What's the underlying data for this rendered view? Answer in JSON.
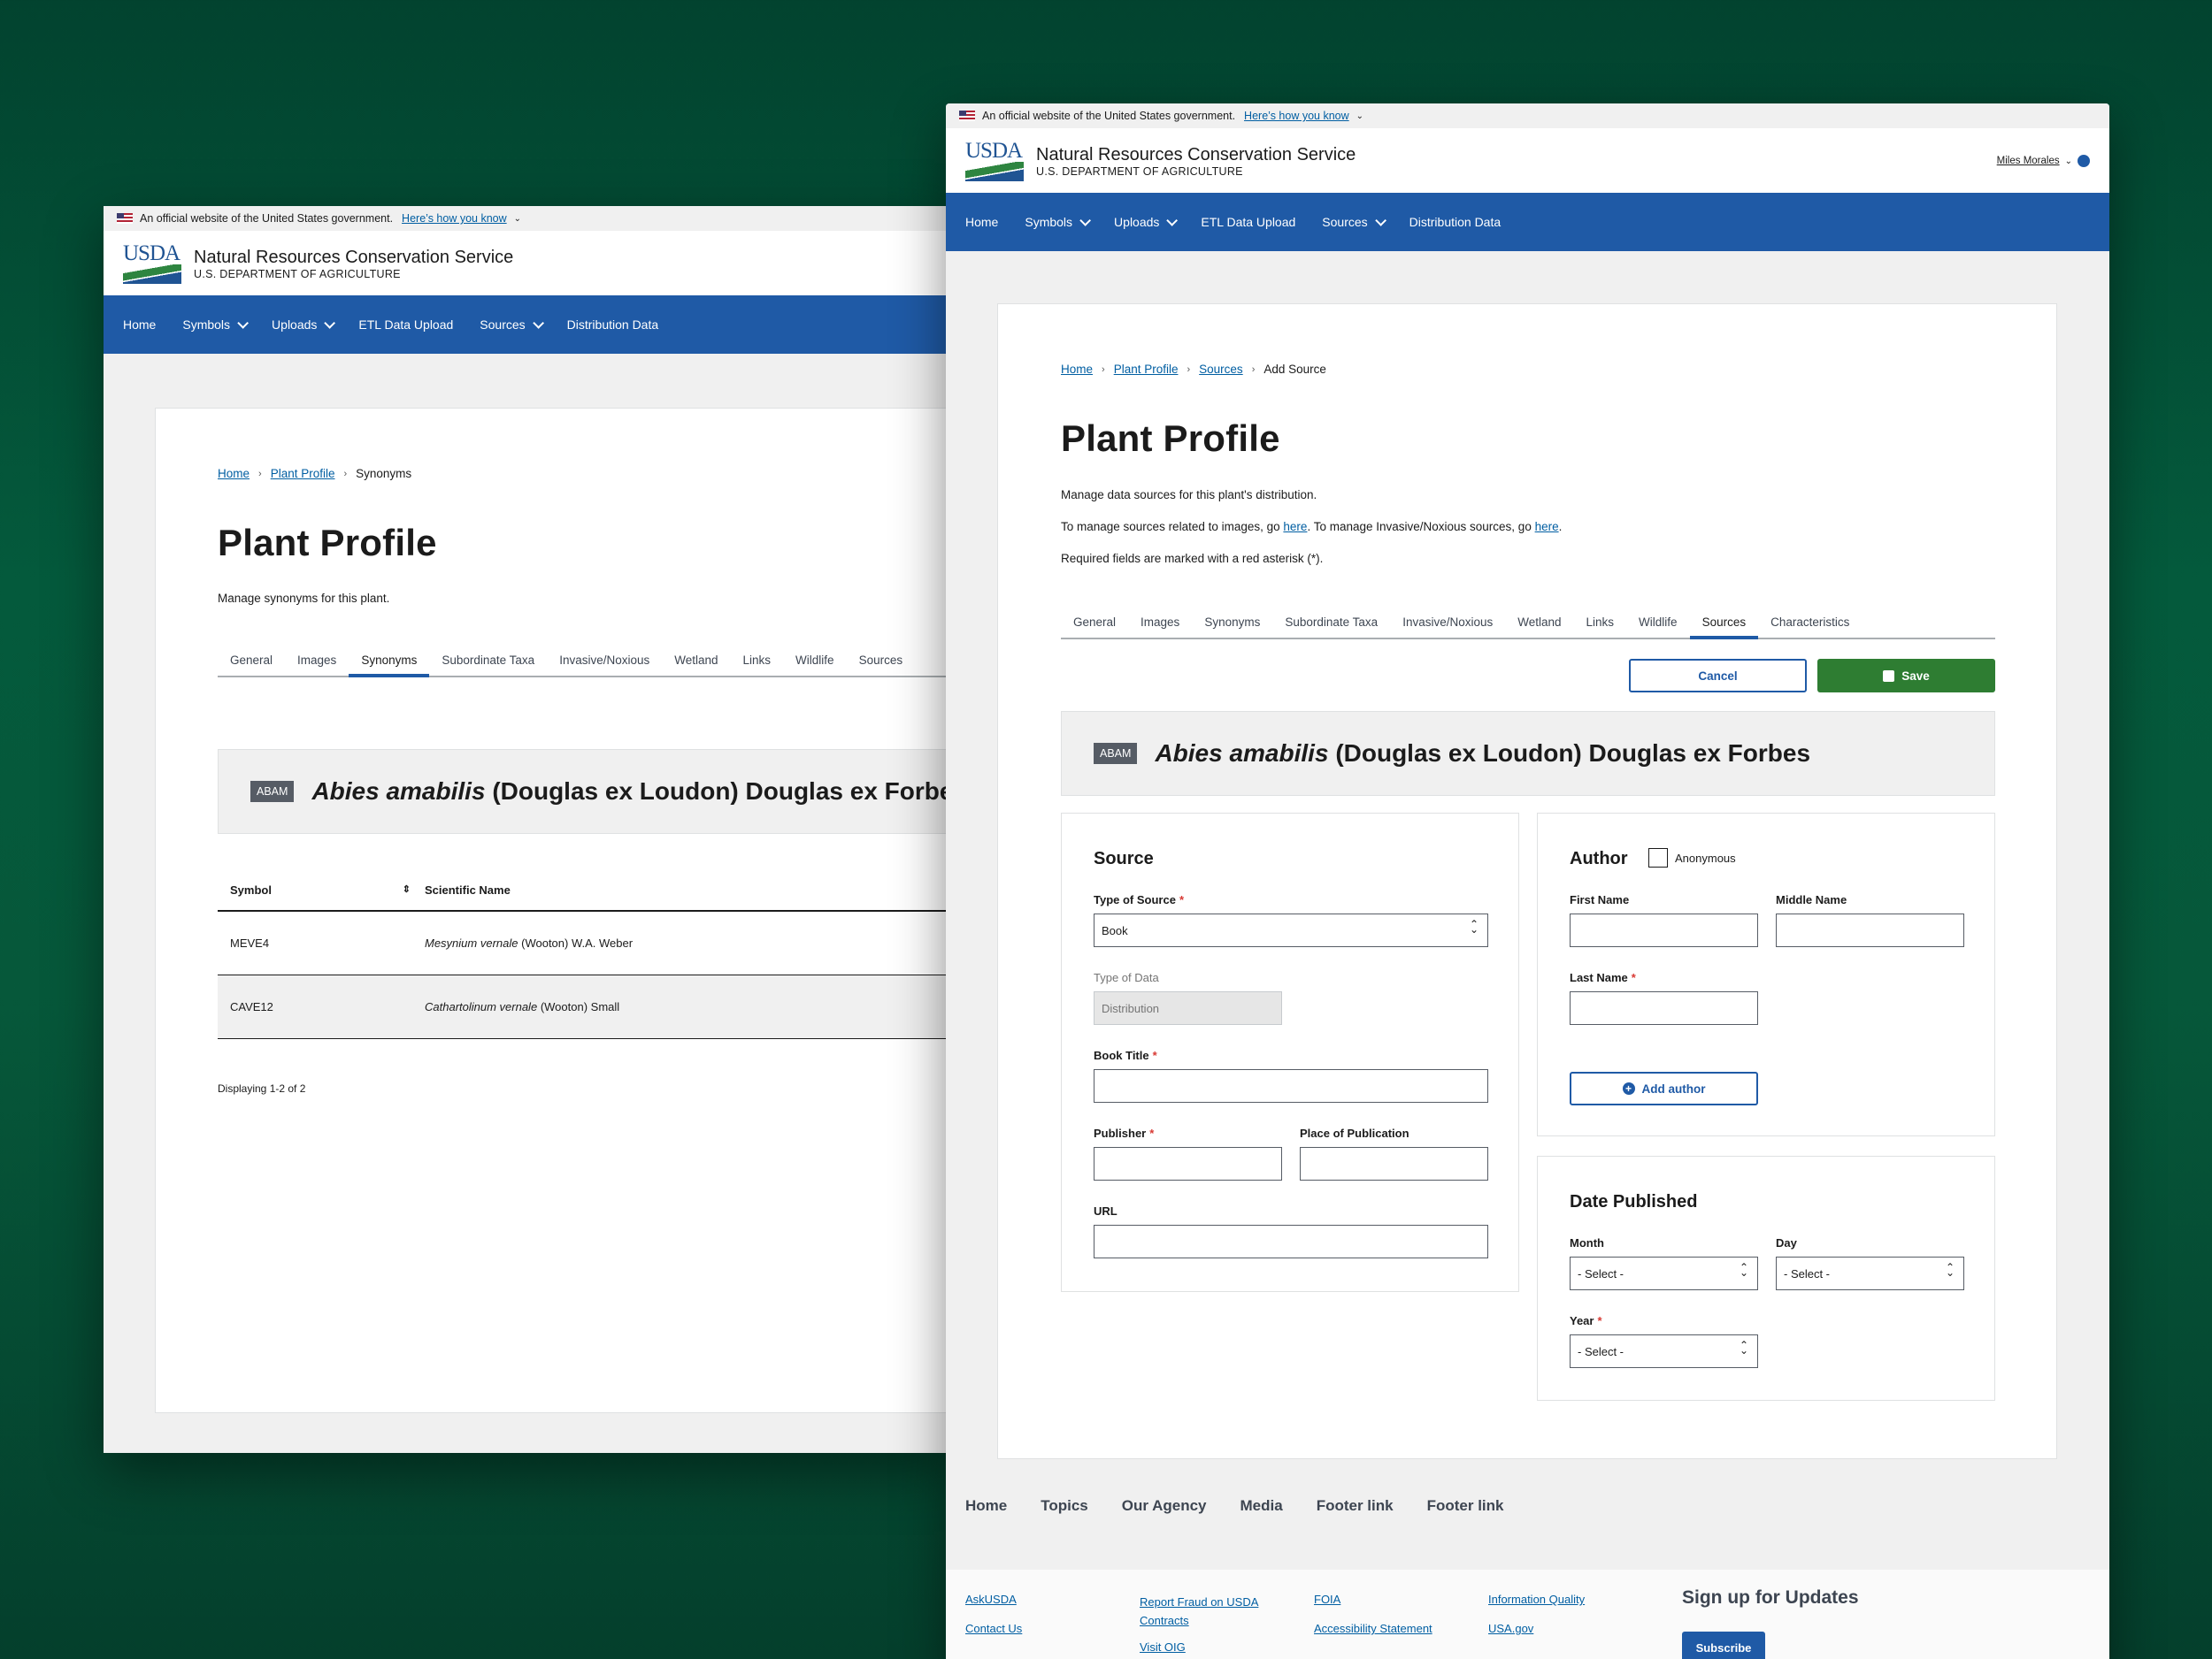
{
  "gov_banner": {
    "text": "An official website of the United States government.",
    "link": "Here’s how you know"
  },
  "header": {
    "logo": "USDA",
    "agency": "Natural Resources Conservation Service",
    "department": "U.S. DEPARTMENT OF AGRICULTURE",
    "user": "Miles Morales"
  },
  "nav": {
    "home": "Home",
    "symbols": "Symbols",
    "uploads": "Uploads",
    "etl": "ETL Data Upload",
    "sources": "Sources",
    "distribution": "Distribution Data"
  },
  "synonyms_page": {
    "breadcrumb": {
      "home": "Home",
      "plant_profile": "Plant Profile",
      "current": "Synonyms"
    },
    "title": "Plant Profile",
    "description": "Manage synonyms for this plant.",
    "tabs": [
      "General",
      "Images",
      "Synonyms",
      "Subordinate Taxa",
      "Invasive/Noxious",
      "Wetland",
      "Links",
      "Wildlife",
      "Sources"
    ],
    "active_tab": "Synonyms",
    "species": {
      "code": "ABAM",
      "genus_species": "Abies amabilis",
      "authority": "(Douglas ex Loudon) Douglas ex Forbes"
    },
    "table": {
      "headers": [
        "Symbol",
        "Scientific Name"
      ],
      "rows": [
        {
          "symbol": "MEVE4",
          "name_italic": "Mesynium vernale",
          "name_rest": "(Wooton) W.A. Weber"
        },
        {
          "symbol": "CAVE12",
          "name_italic": "Cathartolinum vernale",
          "name_rest": "(Wooton) Small"
        }
      ]
    },
    "pagination": "Displaying 1-2 of 2"
  },
  "sources_page": {
    "breadcrumb": {
      "home": "Home",
      "plant_profile": "Plant Profile",
      "sources": "Sources",
      "current": "Add Source"
    },
    "title": "Plant Profile",
    "desc1": "Manage data sources for this plant's distribution.",
    "desc2_a": "To manage sources related to images, go ",
    "desc2_link1": "here",
    "desc2_b": ". To manage Invasive/Noxious sources, go ",
    "desc2_link2": "here",
    "desc2_c": ".",
    "desc3": "Required fields are marked with a red asterisk (*).",
    "tabs": [
      "General",
      "Images",
      "Synonyms",
      "Subordinate Taxa",
      "Invasive/Noxious",
      "Wetland",
      "Links",
      "Wildlife",
      "Sources",
      "Characteristics"
    ],
    "active_tab": "Sources",
    "cancel": "Cancel",
    "save": "Save",
    "species": {
      "code": "ABAM",
      "genus_species": "Abies amabilis",
      "authority": "(Douglas ex Loudon) Douglas ex Forbes"
    },
    "source": {
      "heading": "Source",
      "type_of_source_label": "Type of Source",
      "type_of_source_value": "Book",
      "type_of_data_label": "Type of Data",
      "type_of_data_value": "Distribution",
      "book_title_label": "Book Title",
      "publisher_label": "Publisher",
      "place_label": "Place of Publication",
      "url_label": "URL"
    },
    "author": {
      "heading": "Author",
      "anonymous": "Anonymous",
      "first_name": "First Name",
      "middle_name": "Middle Name",
      "last_name": "Last Name",
      "add_author": "Add author"
    },
    "date": {
      "heading": "Date Published",
      "month": "Month",
      "day": "Day",
      "year": "Year",
      "placeholder": "- Select -"
    }
  },
  "footer": {
    "nav": [
      "Home",
      "Topics",
      "Our Agency",
      "Media",
      "Footer link",
      "Footer link"
    ],
    "col1": [
      "AskUSDA",
      "Contact Us"
    ],
    "col2": [
      "Report Fraud on USDA Contracts",
      "Visit OIG"
    ],
    "col3": [
      "FOIA",
      "Accessibility Statement"
    ],
    "col4": [
      "Information Quality",
      "USA.gov"
    ],
    "signup": "Sign up for Updates",
    "subscribe": "Subscribe"
  }
}
